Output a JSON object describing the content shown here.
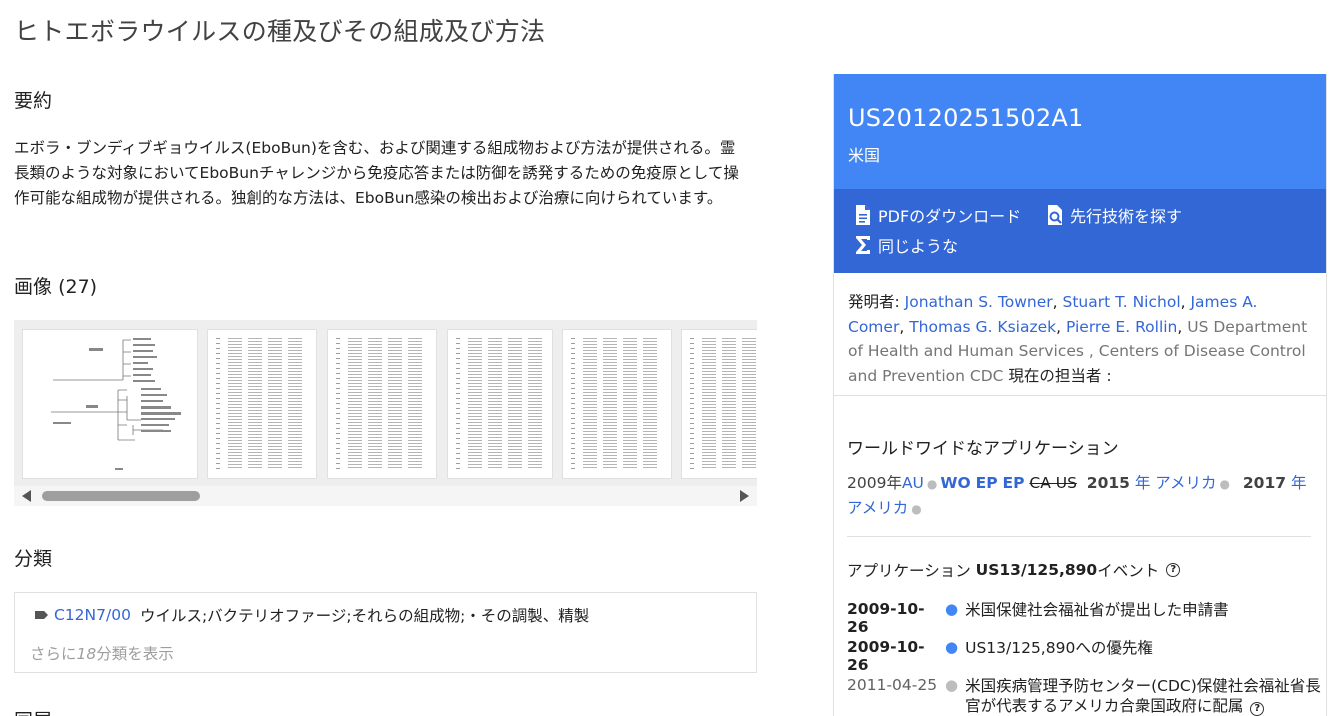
{
  "title": "ヒトエボラウイルスの種及びその組成及び方法",
  "abstract": {
    "heading": "要約",
    "text": "エボラ・ブンディブギョウイルス(EboBun)を含む、および関連する組成物および方法が提供される。霊長類のような対象においてEboBunチャレンジから免疫応答または防御を誘発するための免疫原として操作可能な組成物が提供される。独創的な方法は、EboBun感染の検出および治療に向けられています。"
  },
  "images": {
    "heading": "画像",
    "count": "(27)"
  },
  "classifications": {
    "heading": "分類",
    "code": "C12N7/00",
    "description": "ウイルス;バクテリオファージ;それらの組成物;・その調製、精製",
    "more_prefix": "さらに",
    "more_count": "18",
    "more_suffix": "分類を表示"
  },
  "next_heading": "同属",
  "panel": {
    "pub_number": "US20120251502A1",
    "country": "米国",
    "actions": {
      "pdf": "PDFのダウンロード",
      "prior_art": "先行技術を探す",
      "similar": "同じような"
    },
    "inventors_label": "発明者:",
    "inventors": [
      "Jonathan S. Towner",
      "Stuart T. Nichol",
      "James A. Comer",
      "Thomas G. Ksiazek",
      "Pierre E. Rollin"
    ],
    "assignee": "US Department of Health and Human Services , Centers of Disease Control and Prevention CDC",
    "current_assignee_label": "現在の担当者 :",
    "worldwide_heading": "ワールドワイドなアプリケーション",
    "worldwide": {
      "y2009_year": "2009年",
      "y2009_codes": [
        "AU",
        "WO",
        "EP",
        "EP"
      ],
      "y2009_struck": "CA US",
      "y2015_year": "2015",
      "y2015_label": "年 アメリカ",
      "y2017_year": "2017",
      "y2017_label": "年 アメリカ"
    },
    "events_prefix": "アプリケーション",
    "events_app": "US13/125,890",
    "events_suffix": "イベント",
    "events": [
      {
        "date": "2009-10-26",
        "text": "米国保健社会福祉省が提出した申請書"
      },
      {
        "date": "2009-10-26",
        "text": "US13/125,890への優先権"
      },
      {
        "date": "2011-04-25",
        "text": "米国疾病管理予防センター(CDC)保健社会福祉省長官が代表するアメリカ合衆国政府に配属"
      }
    ]
  },
  "colors": {
    "accent": "#4285f4",
    "accent_dark": "#3367d6",
    "link": "#3367d6"
  }
}
